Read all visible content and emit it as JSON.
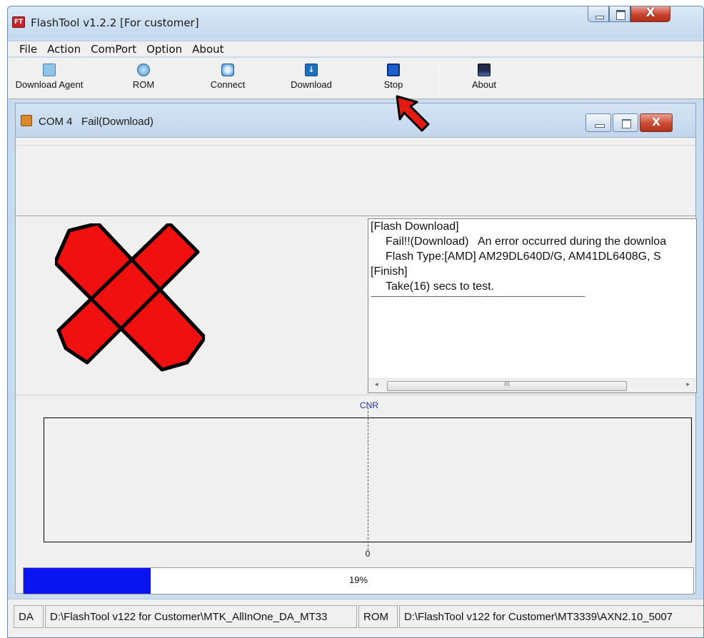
{
  "window": {
    "title": "FlashTool v1.2.2 [For customer]",
    "app_icon_text": "FT",
    "close_glyph": "X"
  },
  "menu": [
    "File",
    "Action",
    "ComPort",
    "Option",
    "About"
  ],
  "toolbar": [
    {
      "label": "Download Agent",
      "icon": "folder-icon",
      "color": "#8fc3e8"
    },
    {
      "label": "ROM",
      "icon": "disc-icon",
      "color": "#3f8fcf"
    },
    {
      "label": "Connect",
      "icon": "connect-icon",
      "color": "#2b7fd1"
    },
    {
      "label": "Download",
      "icon": "download-icon",
      "color": "#1f6fbf"
    },
    {
      "label": "Stop",
      "icon": "stop-icon",
      "color": "#1c5fcf"
    },
    {
      "label": "About",
      "icon": "about-icon",
      "color": "#202a48"
    }
  ],
  "child": {
    "port": "COM 4",
    "status": "Fail(Download)",
    "close_glyph": "X"
  },
  "status_image": {
    "icon": "red-x-fail-icon",
    "fill": "#f01010",
    "stroke": "#000000"
  },
  "log": [
    "[Flash Download]",
    "Fail!!(Download)   An error occurred during the downloa",
    "Flash Type:[AMD] AM29DL640D/G, AM41DL6408G, S",
    "[Finish]",
    "Take(16) secs to test.",
    "~~~~~~~~~~~~~~~~~~~~~~~~~~~~~~~~~~~~~~~~~~~~~~~~~~~~~~~~~~~~"
  ],
  "scroll": {
    "left": "◂",
    "right": "▸",
    "thumb_grip": "III"
  },
  "chart": {
    "label": "CNR",
    "zero_label": "0"
  },
  "progress": {
    "value": 0.19,
    "text": "19%",
    "fill_color": "#0a14f0"
  },
  "statusbar": {
    "da_label": "DA",
    "da_path": "D:\\FlashTool v122 for Customer\\MTK_AllInOne_DA_MT33",
    "rom_label": "ROM",
    "rom_path": "D:\\FlashTool v122 for Customer\\MT3339\\AXN2.10_5007"
  },
  "annotation": {
    "icon": "red-arrow-pointer-icon",
    "color": "#e31b12"
  }
}
